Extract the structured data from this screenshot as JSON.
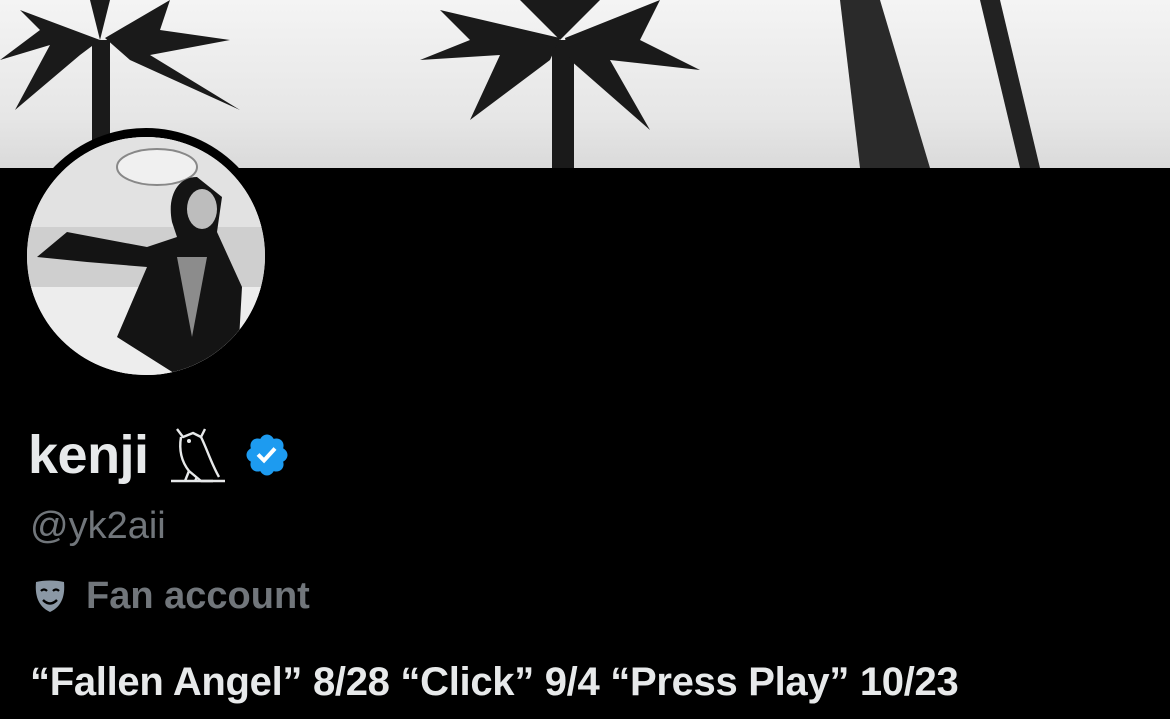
{
  "profile": {
    "display_name": "kenji",
    "handle": "@yk2aii",
    "category": "Fan account",
    "bio": "“Fallen Angel” 8/28 “Click” 9/4 “Press Play” 10/23",
    "badge_icon": "verified-badge-icon",
    "emoji_icon": "owl-icon",
    "category_icon": "theater-mask-icon"
  },
  "colors": {
    "background": "#000000",
    "primary_text": "#e7e9ea",
    "secondary_text": "#71767b",
    "verified_blue": "#1d9bf0"
  }
}
